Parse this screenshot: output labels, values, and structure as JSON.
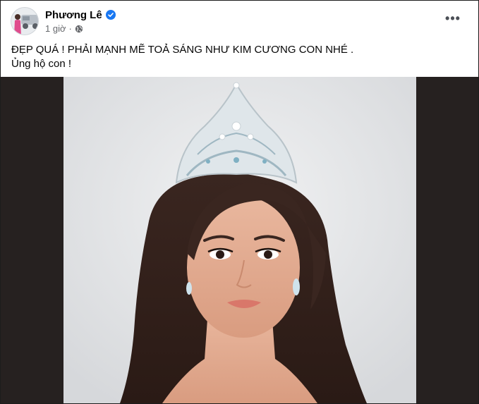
{
  "post": {
    "author_name": "Phương Lê",
    "timestamp": "1 giờ",
    "separator": "·",
    "more_label": "•••",
    "text_line1": "ĐẸP QUÁ ! PHẢI MẠNH MẼ TOẢ SÁNG NHƯ KIM CƯƠNG CON NHÉ .",
    "text_line2": "Ủng hộ con !"
  },
  "icons": {
    "verified": "verified-badge-icon",
    "audience": "globe-icon",
    "more": "more-options-icon"
  },
  "colors": {
    "verified_blue": "#1877f2",
    "meta_gray": "#65676b",
    "photo_bg": "#262120"
  }
}
